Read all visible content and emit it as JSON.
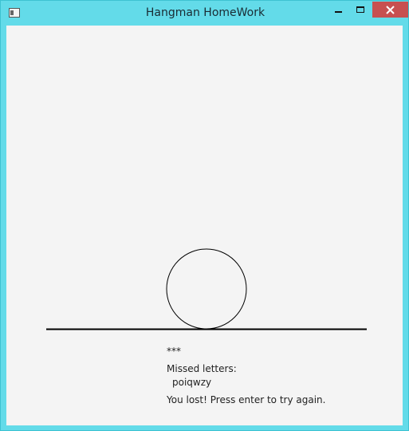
{
  "window": {
    "title": "Hangman HomeWork"
  },
  "icons": {
    "app": "app-window-icon",
    "minimize": "minimize-icon",
    "maximize": "maximize-icon",
    "close": "close-icon"
  },
  "colors": {
    "titlebar": "#63dbe9",
    "close_button": "#c75050",
    "client_background": "#f4f4f4"
  },
  "game": {
    "hidden_word": "***",
    "missed_label": "Missed letters:",
    "missed_letters": "poiqwzy",
    "status_message": "You lost! Press enter to try again."
  }
}
